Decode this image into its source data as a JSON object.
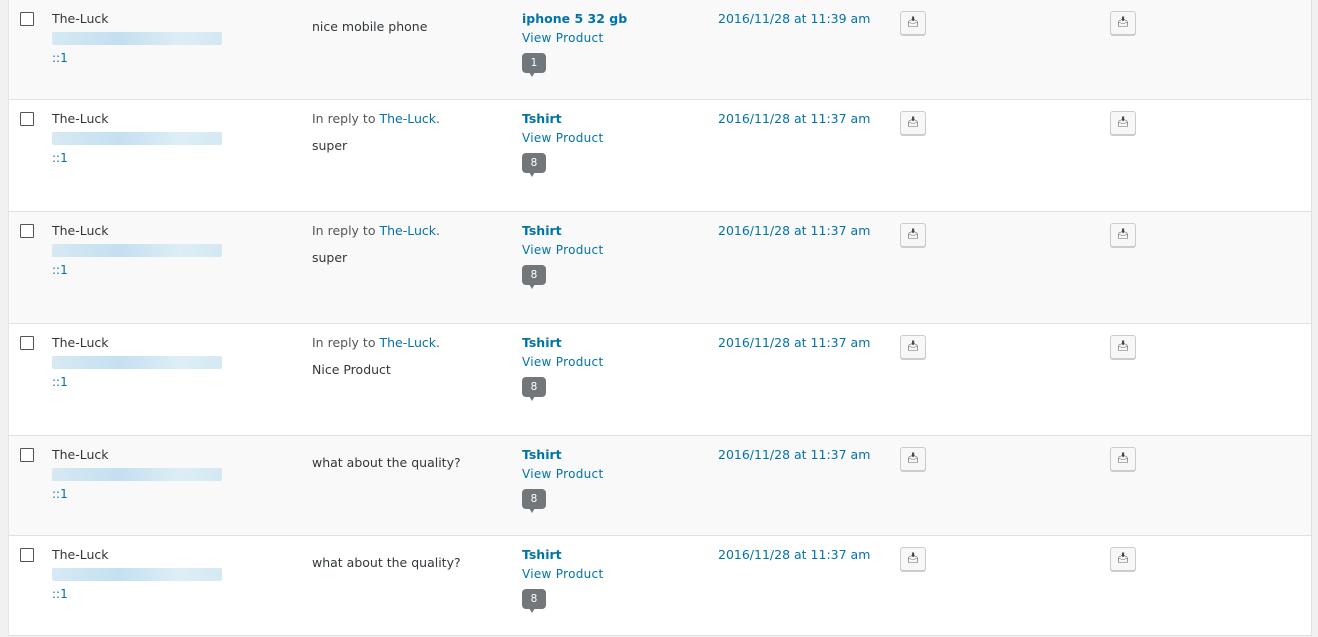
{
  "comments": [
    {
      "author": "The-Luck",
      "ip": "::1",
      "reply_prefix": "",
      "reply_to": "",
      "text": "nice mobile phone",
      "product": "iphone 5 32 gb",
      "view": "View Product",
      "count": "1",
      "date": "2016/11/28 at 11:39 am"
    },
    {
      "author": "The-Luck",
      "ip": "::1",
      "reply_prefix": "In reply to",
      "reply_to": "The-Luck",
      "text": "super",
      "product": "Tshirt",
      "view": "View Product",
      "count": "8",
      "date": "2016/11/28 at 11:37 am"
    },
    {
      "author": "The-Luck",
      "ip": "::1",
      "reply_prefix": "In reply to",
      "reply_to": "The-Luck",
      "text": "super",
      "product": "Tshirt",
      "view": "View Product",
      "count": "8",
      "date": "2016/11/28 at 11:37 am"
    },
    {
      "author": "The-Luck",
      "ip": "::1",
      "reply_prefix": "In reply to",
      "reply_to": "The-Luck",
      "text": "Nice Product",
      "product": "Tshirt",
      "view": "View Product",
      "count": "8",
      "date": "2016/11/28 at 11:37 am"
    },
    {
      "author": "The-Luck",
      "ip": "::1",
      "reply_prefix": "",
      "reply_to": "",
      "text": "what about the quality?",
      "product": "Tshirt",
      "view": "View Product",
      "count": "8",
      "date": "2016/11/28 at 11:37 am"
    },
    {
      "author": "The-Luck",
      "ip": "::1",
      "reply_prefix": "",
      "reply_to": "",
      "text": "what about the quality?",
      "product": "Tshirt",
      "view": "View Product",
      "count": "8",
      "date": "2016/11/28 at 11:37 am"
    }
  ],
  "icons": {
    "action": "download-icon"
  }
}
